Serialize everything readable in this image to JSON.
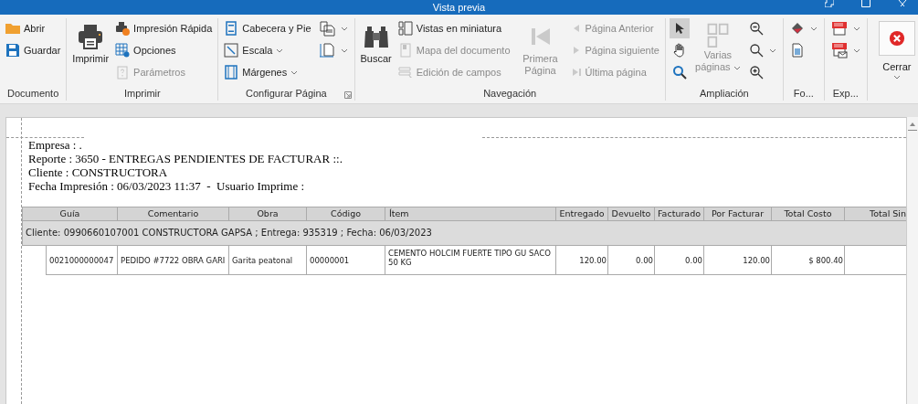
{
  "window": {
    "title": "Vista previa"
  },
  "ribbon": {
    "groups": [
      {
        "label": "Documento",
        "items": [
          {
            "kind": "small",
            "label": "Abrir",
            "disabled": false
          },
          {
            "kind": "small",
            "label": "Guardar",
            "disabled": false
          }
        ]
      },
      {
        "label": "Imprimir",
        "items": [
          {
            "kind": "large",
            "label": "Imprimir",
            "disabled": false
          },
          {
            "kind": "small",
            "label": "Impresión Rápida",
            "disabled": false
          },
          {
            "kind": "small",
            "label": "Opciones",
            "disabled": false
          },
          {
            "kind": "small",
            "label": "Parámetros",
            "disabled": true
          }
        ]
      },
      {
        "label": "Configurar Página",
        "launcher": true,
        "items": [
          {
            "kind": "small",
            "label": "Cabecera y Pie",
            "disabled": false
          },
          {
            "kind": "small",
            "label": "Escala",
            "disabled": false,
            "dropdown": true
          },
          {
            "kind": "small",
            "label": "Márgenes",
            "disabled": false,
            "dropdown": true
          },
          {
            "kind": "icon",
            "disabled": false,
            "dropdown": true
          },
          {
            "kind": "icon",
            "disabled": false,
            "dropdown": true
          }
        ]
      },
      {
        "label": "Navegación",
        "items": [
          {
            "kind": "large",
            "label": "Buscar",
            "disabled": false
          },
          {
            "kind": "small",
            "label": "Vistas en miniatura",
            "disabled": false
          },
          {
            "kind": "small",
            "label": "Mapa del documento",
            "disabled": true
          },
          {
            "kind": "small",
            "label": "Edición de campos",
            "disabled": true
          },
          {
            "kind": "large",
            "label": "Primera Página",
            "disabled": true
          },
          {
            "kind": "small",
            "label": "Página Anterior",
            "disabled": true
          },
          {
            "kind": "small",
            "label": "Página siguiente",
            "disabled": true
          },
          {
            "kind": "small",
            "label": "Última página",
            "disabled": true
          }
        ]
      },
      {
        "label": "Ampliación",
        "items": [
          {
            "kind": "icon",
            "disabled": false,
            "selected": true
          },
          {
            "kind": "icon",
            "disabled": false,
            "selected": false
          },
          {
            "kind": "icon",
            "disabled": false,
            "selected": false
          },
          {
            "kind": "large",
            "label": "Varias páginas",
            "disabled": true,
            "dropdown": true
          },
          {
            "kind": "icon",
            "disabled": false
          },
          {
            "kind": "icon",
            "disabled": false,
            "dropdown": true
          },
          {
            "kind": "icon",
            "disabled": false
          }
        ]
      },
      {
        "label": "Fo...",
        "items": [
          {
            "kind": "icon",
            "disabled": false,
            "dropdown": true
          },
          {
            "kind": "icon",
            "disabled": false
          }
        ]
      },
      {
        "label": "Exp...",
        "items": [
          {
            "kind": "icon",
            "disabled": false,
            "dropdown": true
          },
          {
            "kind": "icon",
            "disabled": false,
            "dropdown": true
          }
        ]
      },
      {
        "items": [
          {
            "kind": "large",
            "label": "Cerrar",
            "disabled": false,
            "dropdown": true
          }
        ]
      }
    ]
  },
  "report": {
    "header_lines": [
      "Empresa : .",
      "Reporte : 3650 - ENTREGAS PENDIENTES DE FACTURAR ::.",
      "Cliente : CONSTRUCTORA",
      "Fecha Impresión : 06/03/2023 11:37  -  Usuario Imprime :"
    ],
    "table": {
      "columns": [
        "Guía",
        "Comentario",
        "Obra",
        "Código",
        "Ítem",
        "Entregado",
        "Devuelto",
        "Facturado",
        "Por Facturar",
        "Total Costo",
        "Total Sin"
      ],
      "group_row": "Cliente: 0990660107001 CONSTRUCTORA GAPSA ; Entrega: 935319 ; Fecha: 06/03/2023",
      "rows": [
        [
          "0021000000047",
          "PEDIDO #7722 OBRA GARI",
          "Garita peatonal",
          "00000001",
          "CEMENTO HOLCIM FUERTE TIPO GU SACO 50 KG",
          "120.00",
          "0.00",
          "0.00",
          "120.00",
          "$ 800.40",
          ""
        ]
      ]
    }
  }
}
